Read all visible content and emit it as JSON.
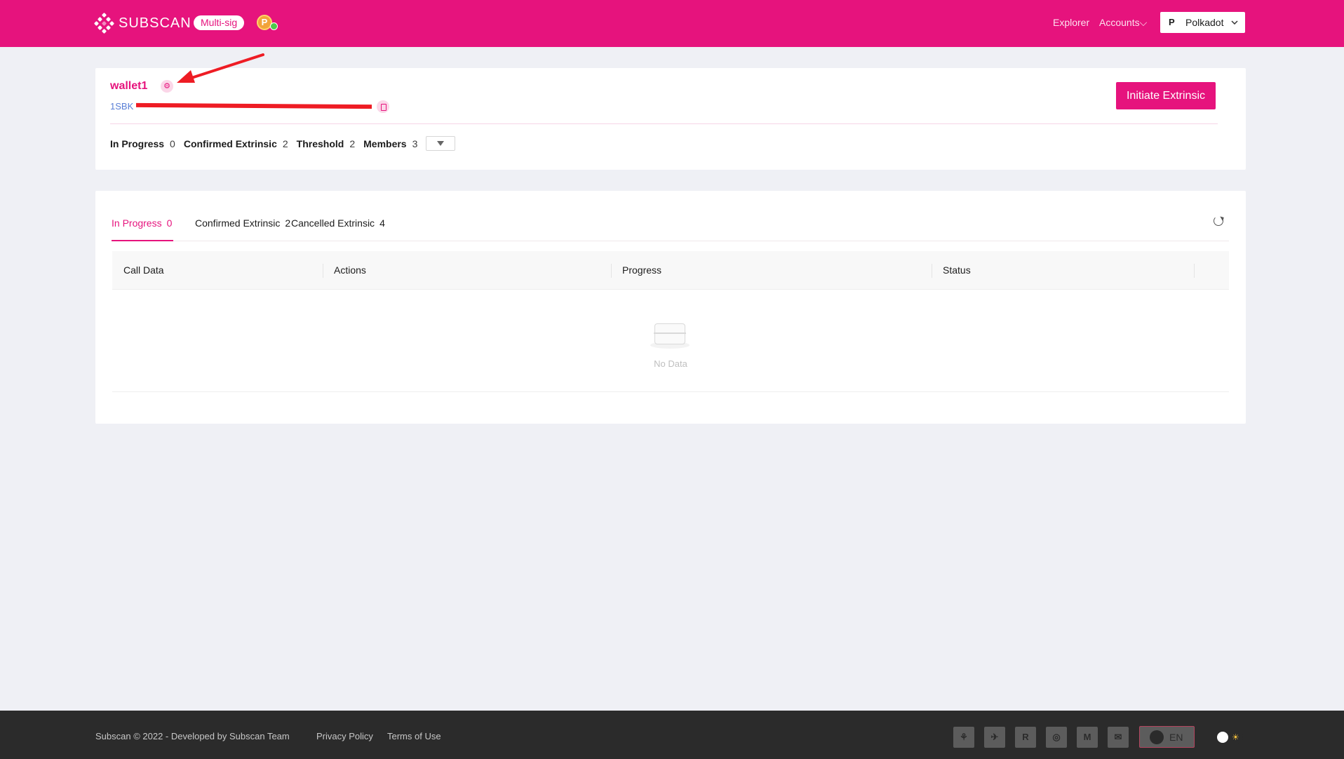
{
  "header": {
    "logo_text": "SUBSCAN",
    "badge": "Multi-sig",
    "avatar_glyph": "P",
    "nav": {
      "explorer": "Explorer",
      "accounts": "Accounts"
    },
    "chain_select": {
      "glyph": "P",
      "value": "Polkadot"
    }
  },
  "wallet": {
    "name": "wallet1",
    "address_visible": "1SBK",
    "initiate_button": "Initiate Extrinsic",
    "stats": [
      {
        "label": "In Progress",
        "value": "0"
      },
      {
        "label": "Confirmed Extrinsic",
        "value": "2"
      },
      {
        "label": "Threshold",
        "value": "2"
      },
      {
        "label": "Members",
        "value": "3"
      }
    ]
  },
  "tabs": [
    {
      "label": "In Progress",
      "count": "0",
      "active": true
    },
    {
      "label": "Confirmed Extrinsic",
      "count": "2",
      "active": false
    },
    {
      "label": "Cancelled Extrinsic",
      "count": "4",
      "active": false
    }
  ],
  "table": {
    "columns": [
      "Call Data",
      "Actions",
      "Progress",
      "Status",
      ""
    ],
    "empty_text": "No Data"
  },
  "footer": {
    "copyright": "Subscan © 2022 - Developed by Subscan Team",
    "privacy": "Privacy Policy",
    "terms": "Terms of Use",
    "social_icons": [
      "element-icon",
      "telegram-icon",
      "r-icon",
      "github-icon",
      "medium-icon",
      "mail-icon"
    ],
    "social_glyphs": [
      "⚘",
      "✈",
      "R",
      "◎",
      "M",
      "✉"
    ],
    "language": "EN",
    "theme_glyph": "☀"
  },
  "colors": {
    "brand": "#e6137d",
    "link": "#5a7fd6",
    "annotation": "#ee1c24",
    "footer_bg": "#2b2b2b"
  }
}
